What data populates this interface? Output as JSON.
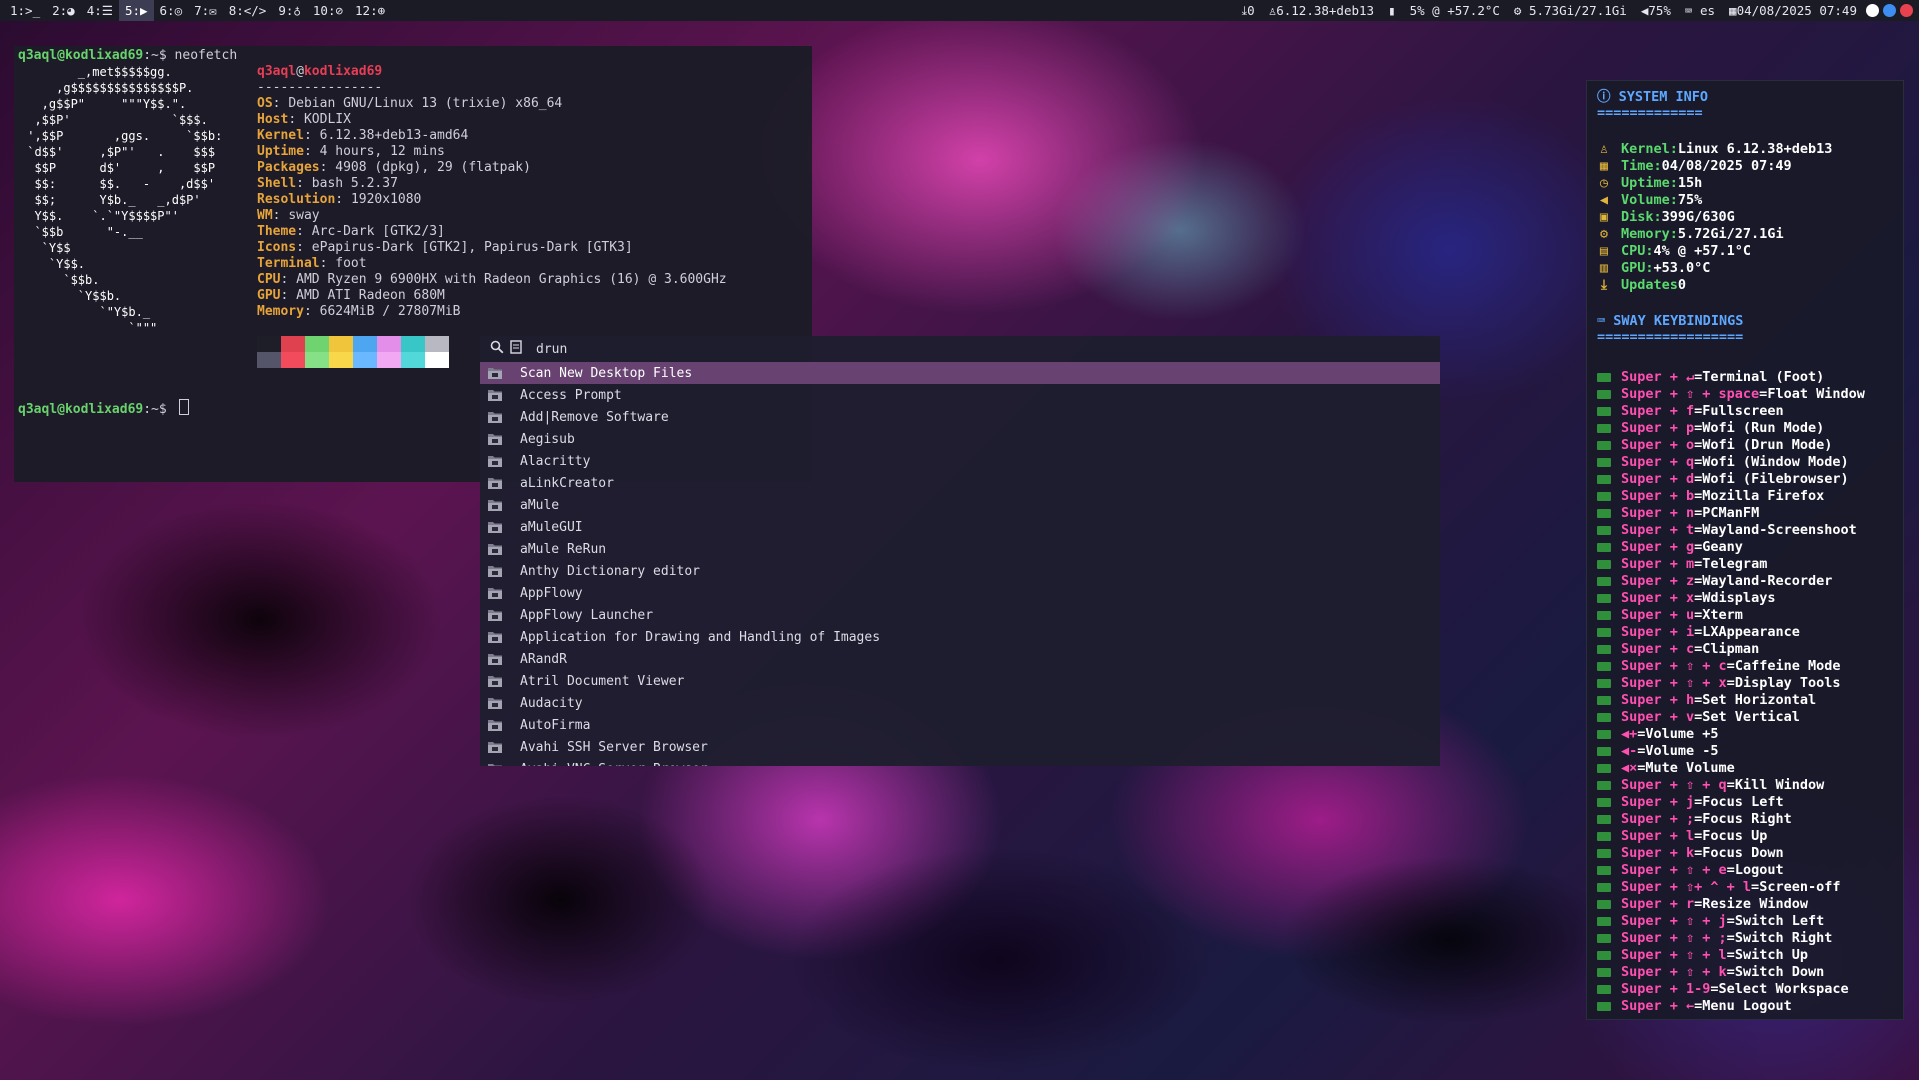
{
  "colors": {
    "bar_bg": "#1b1b26",
    "selected_row": "#684372",
    "prompt_green": "#69d26d",
    "info_key": "#e6a43a",
    "conky_title": "#5ea8ff",
    "conky_key": "#5bd96e",
    "keybind_combo": "#ff4fb0"
  },
  "topbar": {
    "workspaces": [
      {
        "label": "1:>_",
        "active": false
      },
      {
        "label": "2:◕",
        "active": false
      },
      {
        "label": "4:☰",
        "active": false
      },
      {
        "label": "5:▶",
        "active": true
      },
      {
        "label": "6:◎",
        "active": false
      },
      {
        "label": "7:✉",
        "active": false
      },
      {
        "label": "8:</>",
        "active": false
      },
      {
        "label": "9:♁",
        "active": false
      },
      {
        "label": "10:⊘",
        "active": false
      },
      {
        "label": "12:⊕",
        "active": false
      }
    ],
    "updates": "0",
    "kernel": "6.12.38+deb13",
    "cpu": "5% @ +57.2°C",
    "memory": "5.73Gi/27.1Gi",
    "volume": "75%",
    "keyboard": "es",
    "datetime": "04/08/2025 07:49"
  },
  "terminal": {
    "prompt": "q3aql@kodlixad69",
    "prompt_suffix": ":~$ ",
    "command": "neofetch",
    "logo": "        _,met$$$$$gg.\n     ,g$$$$$$$$$$$$$$$P.\n   ,g$$P\"     \"\"\"Y$$.\".\n  ,$$P'              `$$$.\n ',$$P       ,ggs.     `$$b:\n `d$$'     ,$P\"'   .    $$$\n  $$P      d$'     ,    $$P\n  $$:      $$.   -    ,d$$'\n  $$;      Y$b._   _,d$P'\n  Y$$.    `.`\"Y$$$$P\"'\n  `$$b      \"-.__\n   `Y$$\n    `Y$$.\n      `$$b.\n        `Y$$b.\n           `\"Y$b._\n               `\"\"\"",
    "header_user": "q3aql",
    "header_at": "@",
    "header_host": "kodlixad69",
    "separator": "----------------",
    "info": [
      {
        "key": "OS",
        "value": "Debian GNU/Linux 13 (trixie) x86_64"
      },
      {
        "key": "Host",
        "value": "KODLIX"
      },
      {
        "key": "Kernel",
        "value": "6.12.38+deb13-amd64"
      },
      {
        "key": "Uptime",
        "value": "4 hours, 12 mins"
      },
      {
        "key": "Packages",
        "value": "4908 (dpkg), 29 (flatpak)"
      },
      {
        "key": "Shell",
        "value": "bash 5.2.37"
      },
      {
        "key": "Resolution",
        "value": "1920x1080"
      },
      {
        "key": "WM",
        "value": "sway"
      },
      {
        "key": "Theme",
        "value": "Arc-Dark [GTK2/3]"
      },
      {
        "key": "Icons",
        "value": "ePapirus-Dark [GTK2], Papirus-Dark [GTK3]"
      },
      {
        "key": "Terminal",
        "value": "foot"
      },
      {
        "key": "CPU",
        "value": "AMD Ryzen 9 6900HX with Radeon Graphics (16) @ 3.600GHz"
      },
      {
        "key": "GPU",
        "value": "AMD ATI Radeon 680M"
      },
      {
        "key": "Memory",
        "value": "6624MiB / 27807MiB"
      }
    ],
    "palette_top": [
      "#1e1e28",
      "#e0414f",
      "#6fd36f",
      "#f0c53c",
      "#4fa6f0",
      "#e38ee8",
      "#39c6c6",
      "#b8b8c2"
    ],
    "palette_bottom": [
      "#55556a",
      "#f24c5c",
      "#86e086",
      "#f8d84a",
      "#6ab8ff",
      "#f2a8f2",
      "#52d8d8",
      "#ffffff"
    ]
  },
  "launcher": {
    "mode": "drun",
    "items": [
      "Scan New Desktop Files",
      "Access Prompt",
      "Add|Remove Software",
      "Aegisub",
      "Alacritty",
      "aLinkCreator",
      "aMule",
      "aMuleGUI",
      "aMule ReRun",
      "Anthy Dictionary editor",
      "AppFlowy",
      "AppFlowy Launcher",
      "Application for Drawing and Handling of Images",
      "ARandR",
      "Atril Document Viewer",
      "Audacity",
      "AutoFirma",
      "Avahi SSH Server Browser",
      "Avahi VNC Server Browser"
    ]
  },
  "conky": {
    "system_title": "SYSTEM INFO",
    "system_rule": "=============",
    "system": [
      {
        "icon": "penguin-icon",
        "glyph": "♙",
        "key": "Kernel:",
        "value": "Linux 6.12.38+deb13"
      },
      {
        "icon": "calendar-icon",
        "glyph": "▦",
        "key": "Time:",
        "value": "04/08/2025 07:49"
      },
      {
        "icon": "clock-icon",
        "glyph": "◷",
        "key": "Uptime:",
        "value": "15h"
      },
      {
        "icon": "volume-icon",
        "glyph": "◀",
        "key": "Volume:",
        "value": "75%"
      },
      {
        "icon": "disk-icon",
        "glyph": "▣",
        "key": "Disk:",
        "value": "399G/630G"
      },
      {
        "icon": "memory-icon",
        "glyph": "⚙",
        "key": "Memory:",
        "value": "5.72Gi/27.1Gi"
      },
      {
        "icon": "cpu-icon",
        "glyph": "▤",
        "key": "CPU:",
        "value": "4% @ +57.1°C"
      },
      {
        "icon": "gpu-icon",
        "glyph": "▥",
        "key": "GPU:",
        "value": "+53.0°C"
      },
      {
        "icon": "download-icon",
        "glyph": "⤓",
        "key": "Updates",
        "value": "0"
      }
    ],
    "keys_title": "SWAY KEYBINDINGS",
    "keys_rule": "==================",
    "keys": [
      {
        "combo": "Super + ↵",
        "desc": "Terminal (Foot)"
      },
      {
        "combo": "Super + ⇧ + space",
        "desc": "Float Window"
      },
      {
        "combo": "Super + f",
        "desc": "Fullscreen"
      },
      {
        "combo": "Super + p",
        "desc": "Wofi (Run Mode)"
      },
      {
        "combo": "Super + o",
        "desc": "Wofi (Drun Mode)"
      },
      {
        "combo": "Super + q",
        "desc": "Wofi (Window Mode)"
      },
      {
        "combo": "Super + d",
        "desc": "Wofi (Filebrowser)"
      },
      {
        "combo": "Super + b",
        "desc": "Mozilla Firefox"
      },
      {
        "combo": "Super + n",
        "desc": "PCManFM"
      },
      {
        "combo": "Super + t",
        "desc": "Wayland-Screenshoot"
      },
      {
        "combo": "Super + g",
        "desc": "Geany"
      },
      {
        "combo": "Super + m",
        "desc": "Telegram"
      },
      {
        "combo": "Super + z",
        "desc": "Wayland-Recorder"
      },
      {
        "combo": "Super + x",
        "desc": "Wdisplays"
      },
      {
        "combo": "Super + u",
        "desc": "Xterm"
      },
      {
        "combo": "Super + i",
        "desc": "LXAppearance"
      },
      {
        "combo": "Super + c",
        "desc": "Clipman"
      },
      {
        "combo": "Super + ⇧ + c",
        "desc": "Caffeine Mode"
      },
      {
        "combo": "Super + ⇧ + x",
        "desc": "Display Tools"
      },
      {
        "combo": "Super + h",
        "desc": "Set Horizontal"
      },
      {
        "combo": "Super + v",
        "desc": "Set Vertical"
      },
      {
        "combo": "◀+",
        "desc": "Volume +5"
      },
      {
        "combo": "◀-",
        "desc": "Volume -5"
      },
      {
        "combo": "◀×",
        "desc": "Mute Volume"
      },
      {
        "combo": "Super + ⇧ + q",
        "desc": "Kill Window"
      },
      {
        "combo": "Super + j",
        "desc": "Focus Left"
      },
      {
        "combo": "Super + ;",
        "desc": "Focus Right"
      },
      {
        "combo": "Super + l",
        "desc": "Focus Up"
      },
      {
        "combo": "Super + k",
        "desc": "Focus Down"
      },
      {
        "combo": "Super + ⇧ + e",
        "desc": "Logout"
      },
      {
        "combo": "Super + ⇧+ ^ + l",
        "desc": "Screen-off"
      },
      {
        "combo": "Super + r",
        "desc": "Resize Window"
      },
      {
        "combo": "Super + ⇧ + j",
        "desc": "Switch Left"
      },
      {
        "combo": "Super + ⇧ + ;",
        "desc": "Switch Right"
      },
      {
        "combo": "Super + ⇧ + l",
        "desc": "Switch Up"
      },
      {
        "combo": "Super + ⇧ + k",
        "desc": "Switch Down"
      },
      {
        "combo": "Super + 1-9",
        "desc": "Select Workspace"
      },
      {
        "combo": "Super + ←",
        "desc": "Menu Logout"
      }
    ]
  }
}
